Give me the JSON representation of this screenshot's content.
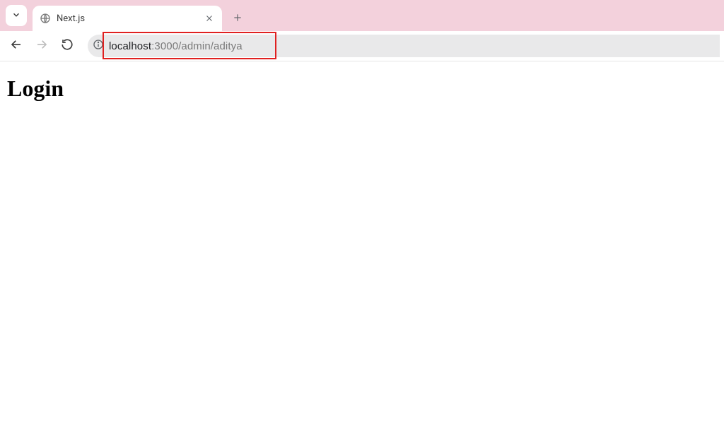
{
  "browser": {
    "tab": {
      "title": "Next.js"
    },
    "url": {
      "host": "localhost",
      "path": ":3000/admin/aditya"
    }
  },
  "page": {
    "heading": "Login"
  }
}
